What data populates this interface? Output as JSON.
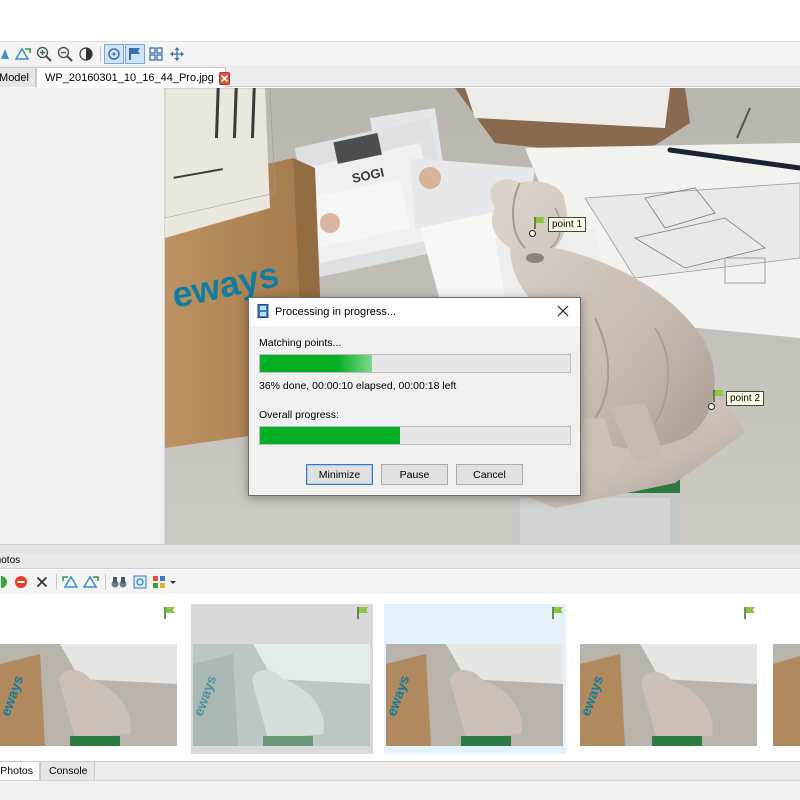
{
  "document_tabs": [
    {
      "label": "Model"
    },
    {
      "label": "WP_20160301_10_16_44_Pro.jpg"
    }
  ],
  "toolbar_icons": [
    "rotate-left-icon",
    "rotate-right-icon",
    "zoom-in-icon",
    "zoom-out-icon",
    "contrast-icon",
    "fit-view-icon",
    "flag-tool-icon",
    "grid-tool-icon",
    "move-icon"
  ],
  "image_text": {
    "box_brand": "eways",
    "doc_brand": "SOGI"
  },
  "markers": [
    {
      "label": "point 1"
    },
    {
      "label": "point 2"
    }
  ],
  "dialog": {
    "title": "Processing in progress...",
    "stage_label": "Matching points...",
    "stage_progress": 0.36,
    "status_text": "36% done, 00:00:10 elapsed, 00:00:18 left",
    "overall_label": "Overall progress:",
    "overall_progress": 0.45,
    "buttons": {
      "minimize": "Minimize",
      "pause": "Pause",
      "cancel": "Cancel"
    },
    "progress_color": "#06b025"
  },
  "photos_panel": {
    "title": "Photos",
    "toolbar_icons": [
      "add-photo-icon",
      "remove-photo-icon",
      "delete-icon",
      "rotate-left-icon",
      "rotate-right-icon",
      "binoculars-icon",
      "fit-icon",
      "view-mode-icon"
    ],
    "thumbnails": [
      {
        "state": "normal",
        "flag": true
      },
      {
        "state": "disabled",
        "flag": true
      },
      {
        "state": "selected",
        "flag": true
      },
      {
        "state": "normal",
        "flag": true
      },
      {
        "state": "normal",
        "flag": false
      }
    ]
  },
  "bottom_tabs": [
    {
      "label": "Photos"
    },
    {
      "label": "Console"
    }
  ],
  "colors": {
    "flag_green": "#8cc63f",
    "selection_bg": "#e5f1fb",
    "disabled_bg": "#d9d9d9"
  }
}
